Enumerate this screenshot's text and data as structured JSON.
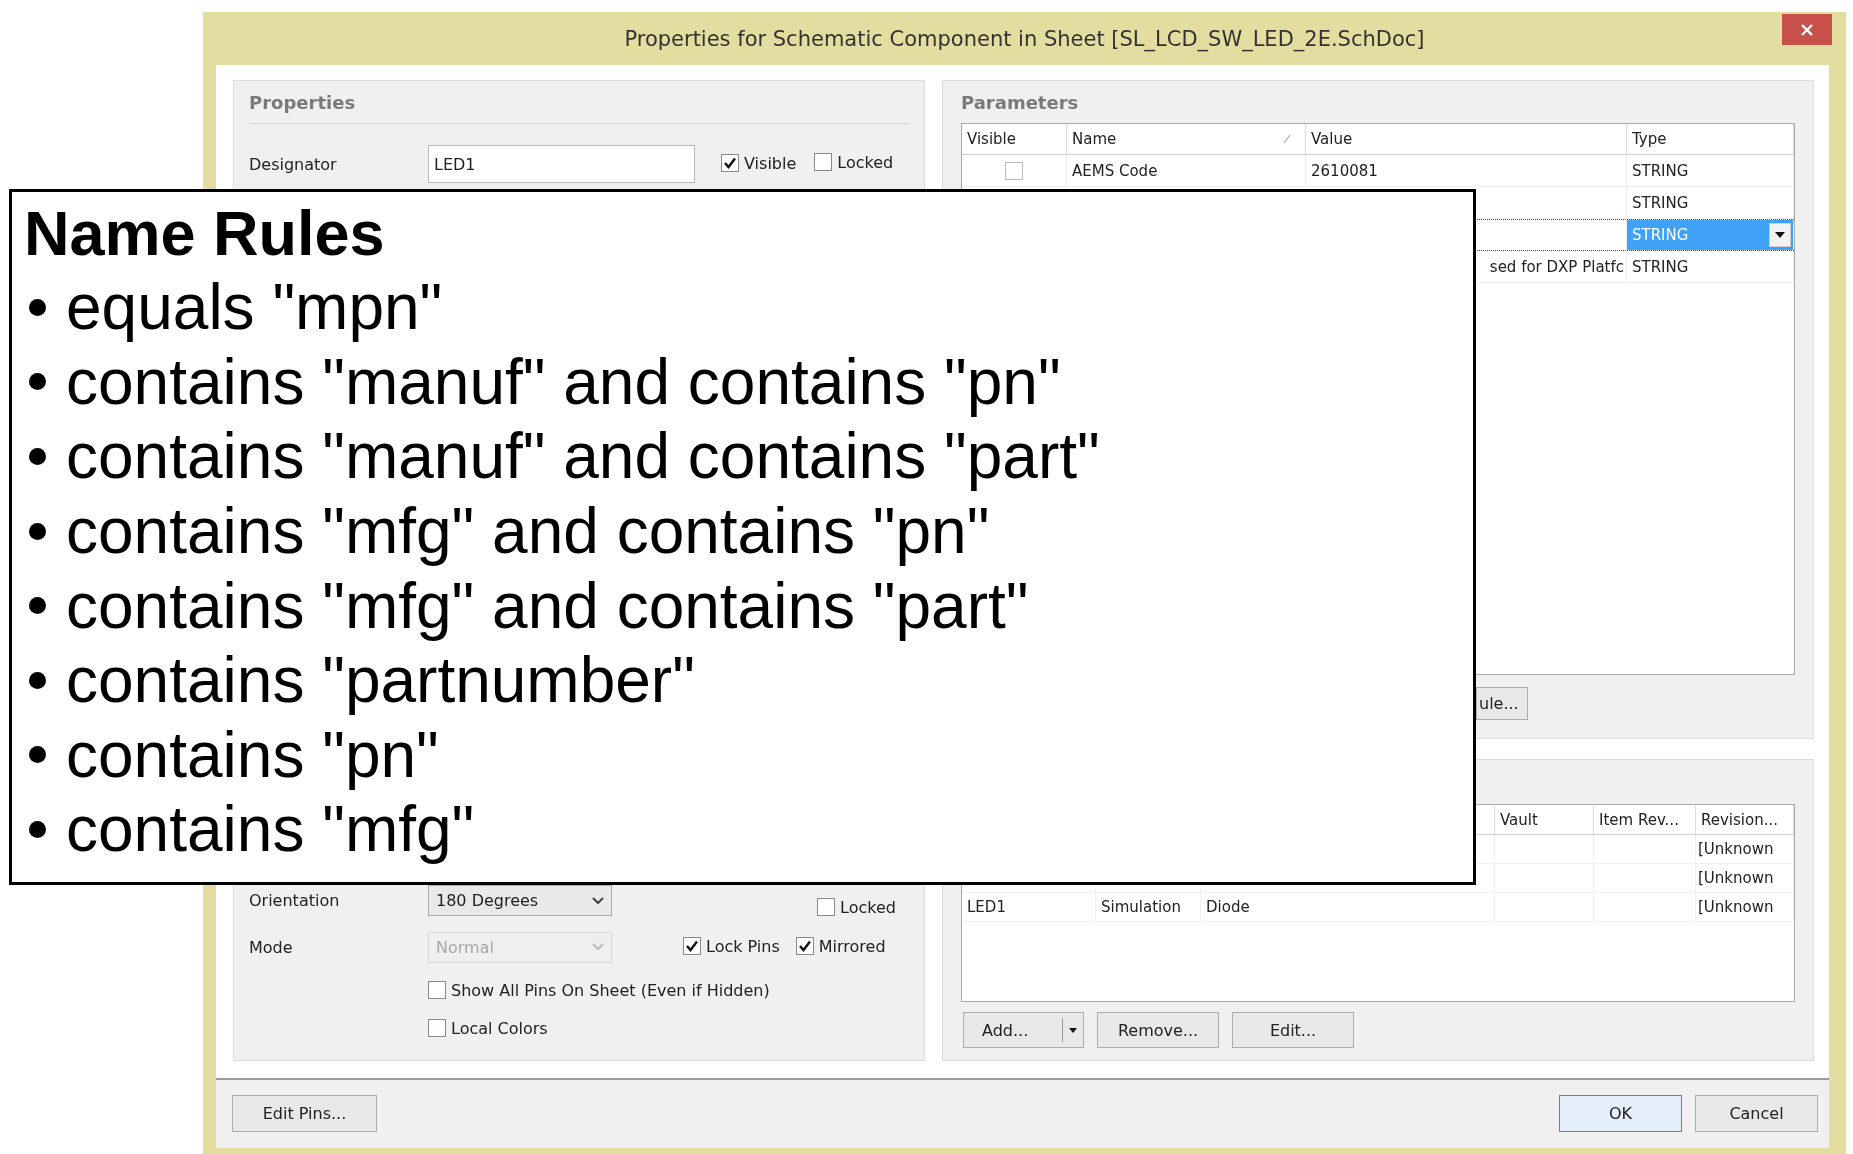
{
  "window": {
    "title": "Properties for Schematic Component in Sheet [SL_LCD_SW_LED_2E.SchDoc]"
  },
  "properties": {
    "title": "Properties",
    "designator": {
      "label": "Designator",
      "value": "LED1"
    },
    "designator_checks": [
      {
        "label": "Visible",
        "checked": true
      },
      {
        "label": "Locked",
        "checked": false
      }
    ],
    "orientation": {
      "label": "Orientation",
      "value": "180 Degrees",
      "disabled": false
    },
    "orientation_locked": {
      "label": "Locked",
      "checked": false
    },
    "mode": {
      "label": "Mode",
      "value": "Normal",
      "disabled": true
    },
    "mode_checks": [
      {
        "label": "Lock Pins",
        "checked": true
      },
      {
        "label": "Mirrored",
        "checked": true
      }
    ],
    "options": [
      {
        "label": "Show All Pins On Sheet (Even if Hidden)",
        "checked": false
      },
      {
        "label": "Local Colors",
        "checked": false
      }
    ]
  },
  "parameters": {
    "title": "Parameters",
    "columns": [
      "Visible",
      "Name",
      "Value",
      "Type"
    ],
    "rows": [
      {
        "visible": false,
        "name": "AEMS Code",
        "value": "2610081",
        "type": "STRING",
        "selected": false
      },
      {
        "type": "STRING",
        "selected": false
      },
      {
        "type": "STRING",
        "selected": true
      },
      {
        "value": "sed for DXP Platfc",
        "type": "STRING",
        "selected": false
      }
    ],
    "button": "ule..."
  },
  "models": {
    "columns": [
      "Vault",
      "Item Rev...",
      "Revision..."
    ],
    "rows": [
      {
        "revision": "[Unknown"
      },
      {
        "revision": "[Unknown"
      },
      {
        "column_1": "LED1",
        "column_2": "Simulation",
        "column_3": "Diode",
        "revision": "[Unknown"
      }
    ],
    "buttons": [
      "Add...",
      "Remove...",
      "Edit..."
    ]
  },
  "footer": {
    "left_button": "Edit Pins...",
    "buttons": [
      "OK",
      "Cancel"
    ]
  },
  "callout": {
    "title": "Name Rules",
    "rules": [
      "equals \"mpn\"",
      "contains \"manuf\" and contains \"pn\"",
      "contains \"manuf\" and contains \"part\"",
      "contains \"mfg\" and contains \"pn\"",
      "contains \"mfg\" and contains \"part\"",
      "contains \"partnumber\"",
      "contains \"pn\"",
      "contains \"mfg\""
    ]
  }
}
